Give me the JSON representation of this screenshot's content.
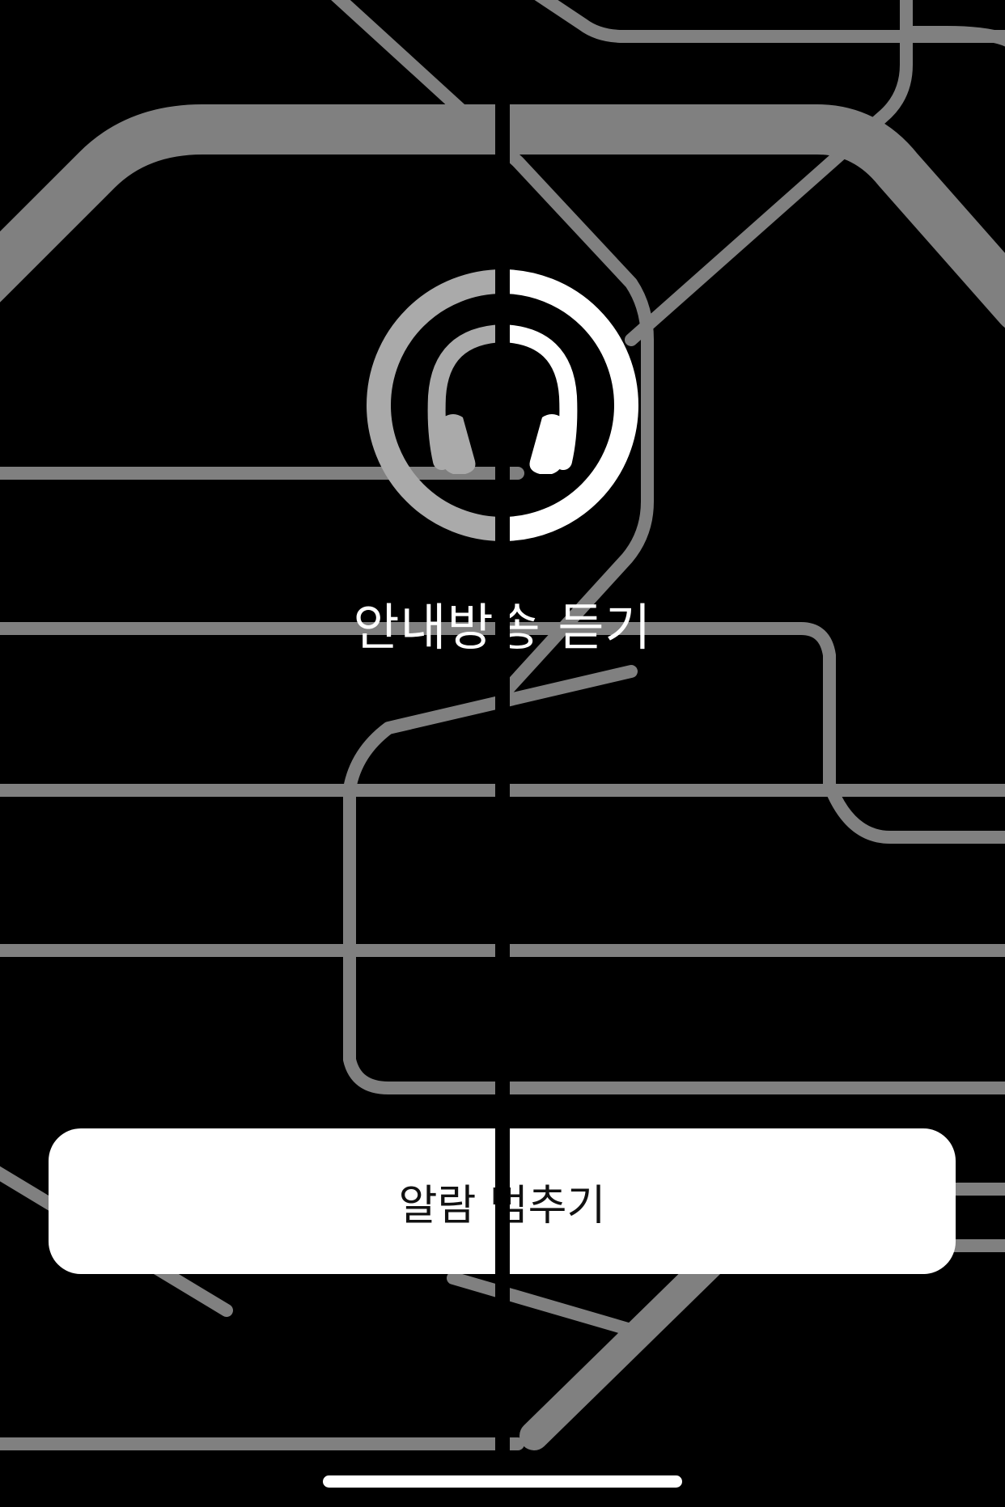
{
  "listen": {
    "label": "안내방송 듣기",
    "icon": "headphones-icon"
  },
  "alarm": {
    "stop_label": "알람 멈추기"
  },
  "colors": {
    "background": "#000000",
    "map_line": "#808080",
    "icon_left": "#aaaaaa",
    "icon_right": "#ffffff",
    "button_bg": "#ffffff",
    "button_text": "#111111"
  }
}
